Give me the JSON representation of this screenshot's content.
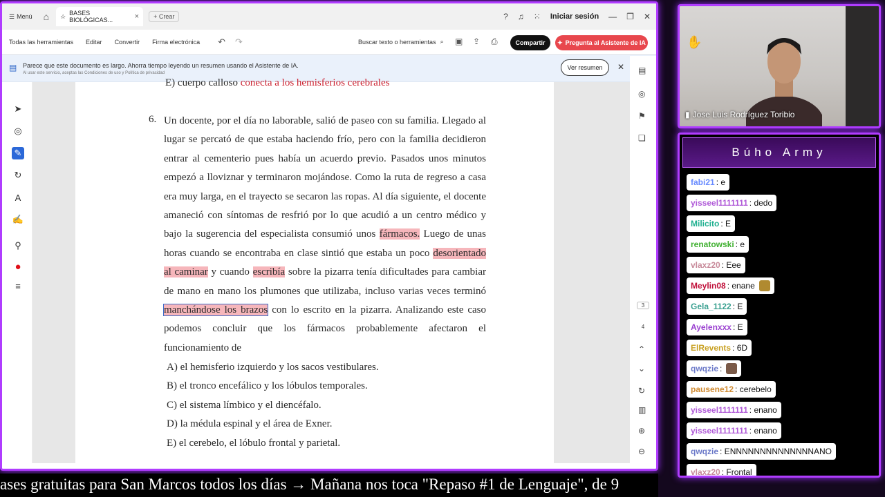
{
  "titlebar": {
    "menu_label": "Menú",
    "tab_title": "BASES BIOLÓGICAS...",
    "create_label": "Crear",
    "signin_label": "Iniciar sesión"
  },
  "toolbar": {
    "items": [
      "Todas las herramientas",
      "Editar",
      "Convertir",
      "Firma electrónica"
    ],
    "search_label": "Buscar texto o herramientas",
    "share_label": "Compartir",
    "ai_label": "Pregunta al Asistente de IA"
  },
  "banner": {
    "message": "Parece que este documento es largo. Ahorra tiempo leyendo un resumen usando el Asistente de IA.",
    "fine_print": "Al usar este servicio, aceptas las Condiciones de uso y Política de privacidad",
    "summary_button": "Ver resumen"
  },
  "document": {
    "prev_option_prefix": "E)  cuerpo calloso ",
    "prev_option_red": "conecta a los hemisferios cerebrales",
    "question_number": "6.",
    "q_part1": "Un docente, por el día no laborable, salió de paseo con su familia. Llegado al lugar se percató de que estaba haciendo frío, pero con la familia decidieron entrar al cementerio pues había un acuerdo previo. Pasados unos minutos empezó a lloviznar y terminaron mojándose. Como la ruta de regreso a casa era muy larga, en el trayecto se secaron las ropas. Al día siguiente, el docente amaneció con síntomas de resfrió por lo que acudió a un centro médico y bajo la sugerencia del especialista consumió unos ",
    "hl1": "fármacos.",
    "q_part2": " Luego de unas horas cuando se encontraba en clase sintió que estaba un poco ",
    "hl2": "desorientado al caminar",
    "q_part3": " y cuando ",
    "hl3": "escribía",
    "q_part4": " sobre la pizarra tenía dificultades para cambiar de mano en mano los plumones que utilizaba, incluso varias veces terminó ",
    "hl4": "manchándose los brazos",
    "q_part5": " con lo escrito en la pizarra. Analizando este caso podemos concluir que los fármacos probablemente afectaron el funcionamiento de",
    "options": [
      "A)  el hemisferio izquierdo y los sacos vestibulares.",
      "B)  el tronco encefálico y los lóbulos temporales.",
      "C)  el sistema límbico y el diencéfalo.",
      "D)  la médula espinal y el área de Exner.",
      "E)  el cerebelo, el lóbulo frontal y parietal."
    ]
  },
  "page_indicator": {
    "current": "3",
    "next": "4"
  },
  "webcam": {
    "name": "Jose Luis Rodríguez Toribio"
  },
  "chat": {
    "title": "Búho Army",
    "messages": [
      {
        "user": "fabi21",
        "text": ": e",
        "color": "#6a8cff",
        "emoji": ""
      },
      {
        "user": "yisseel1111111",
        "text": ": dedo",
        "color": "#b05ad8",
        "emoji": ""
      },
      {
        "user": "Milicito",
        "text": ": E",
        "color": "#20b090",
        "emoji": ""
      },
      {
        "user": "renatowski",
        "text": ": e",
        "color": "#40b030",
        "emoji": ""
      },
      {
        "user": "vlaxz20",
        "text": ": Eee",
        "color": "#c88a9a",
        "emoji": ""
      },
      {
        "user": "Meylin08",
        "text": ": enane",
        "color": "#c0103a",
        "emoji": "#b08a30"
      },
      {
        "user": "Gela_1122",
        "text": ": E",
        "color": "#3aa090",
        "emoji": ""
      },
      {
        "user": "Ayelenxxx",
        "text": ": E",
        "color": "#9a40d0",
        "emoji": ""
      },
      {
        "user": "ElRevents",
        "text": ": 6D",
        "color": "#c8a020",
        "emoji": ""
      },
      {
        "user": "qwqzie",
        "text": ":",
        "color": "#6a78c8",
        "emoji": "#7a5a48"
      },
      {
        "user": "pausene12",
        "text": ": cerebelo",
        "color": "#d08a30",
        "emoji": ""
      },
      {
        "user": "yisseel1111111",
        "text": ": enano",
        "color": "#b05ad8",
        "emoji": ""
      },
      {
        "user": "yisseel1111111",
        "text": ": enano",
        "color": "#b05ad8",
        "emoji": ""
      },
      {
        "user": "qwqzie",
        "text": ": ENNNNNNNNNNNNNNANO",
        "color": "#6a78c8",
        "emoji": ""
      },
      {
        "user": "vlaxz20",
        "text": ": Frontal",
        "color": "#c88a9a",
        "emoji": ""
      }
    ]
  },
  "ticker": {
    "text": "ases gratuitas para San Marcos todos los días  →  Mañana nos toca \"Repaso #1 de Lenguaje\", de 9"
  },
  "colors": {
    "accent_purple": "#b03cff",
    "highlight": "#f6b6bb",
    "ai_button": "#e8474d"
  }
}
